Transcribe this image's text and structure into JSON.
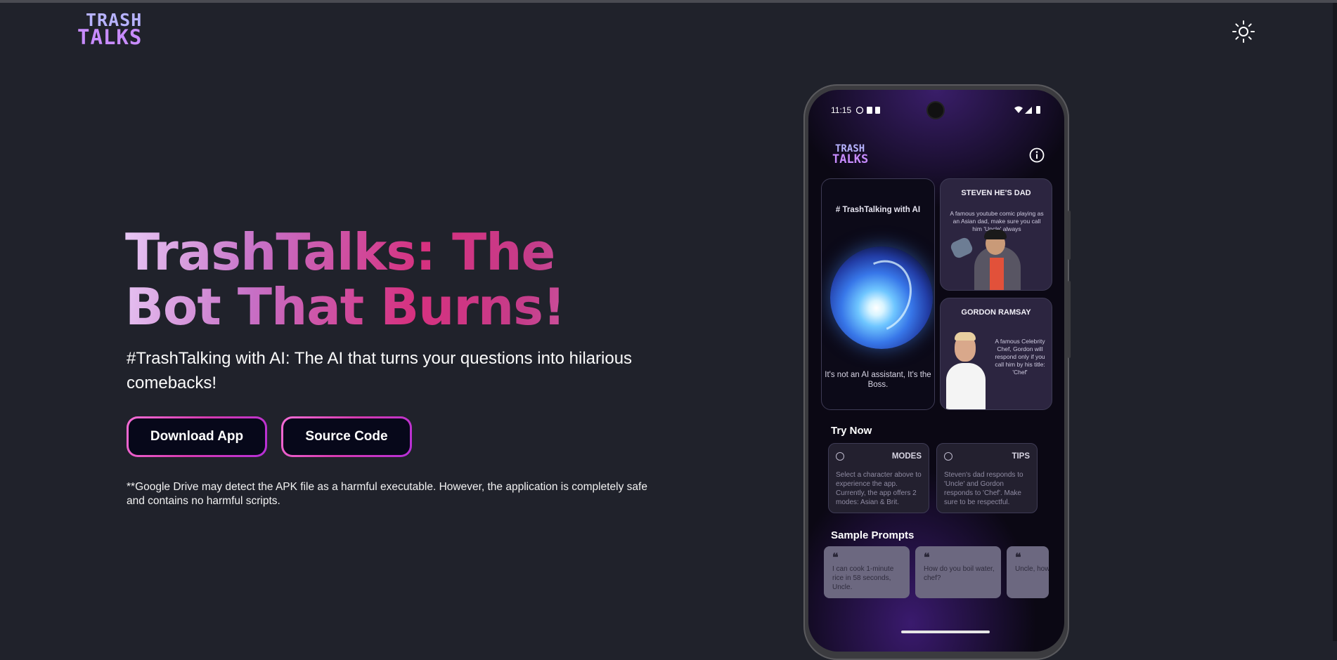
{
  "brand": {
    "line1": "TRASH",
    "line2": "TALKS"
  },
  "header": {
    "theme_toggle_icon": "sun-icon"
  },
  "hero": {
    "title": "TrashTalks: The Bot That Burns!",
    "subtitle": "#TrashTalking with AI: The AI that turns your questions into hilarious comebacks!",
    "download_label": "Download App",
    "source_label": "Source Code",
    "disclaimer": "**Google Drive may detect the APK file as a harmful executable. However, the application is completely safe and contains no harmful scripts."
  },
  "colors": {
    "background": "#20222b",
    "button_fill": "#07081a",
    "button_border": "#d63bb0",
    "title_gradient": [
      "#e8c8f5",
      "#c770c6",
      "#d6317f",
      "#dd7dc4"
    ]
  },
  "phone": {
    "status": {
      "time": "11:15"
    },
    "app_logo": {
      "line1": "TRASH",
      "line2": "TALKS"
    },
    "main_card": {
      "hashtag": "# TrashTalking with AI",
      "caption": "It's not an AI assistant, It's the Boss."
    },
    "characters": [
      {
        "name": "STEVEN HE'S DAD",
        "description": "A famous youtube comic playing as an Asian dad, make sure you call him 'Uncle' always"
      },
      {
        "name": "GORDON RAMSAY",
        "description": "A famous Celebrity Chef, Gordon will respond only if you call him by his title: 'Chef'"
      }
    ],
    "try_now": {
      "heading": "Try Now",
      "cards": [
        {
          "title": "MODES",
          "body": "Select a character above to experience the app. Currently, the app offers 2 modes: Asian & Brit."
        },
        {
          "title": "TIPS",
          "body": "Steven's dad responds to 'Uncle' and Gordon responds to 'Chef'. Make sure to be respectful."
        }
      ]
    },
    "sample_prompts": {
      "heading": "Sample Prompts",
      "quote_mark": "❝",
      "items": [
        "I can cook 1-minute rice in 58 seconds, Uncle.",
        "How do you boil water, chef?",
        "Uncle, how girlfriend?"
      ]
    }
  }
}
